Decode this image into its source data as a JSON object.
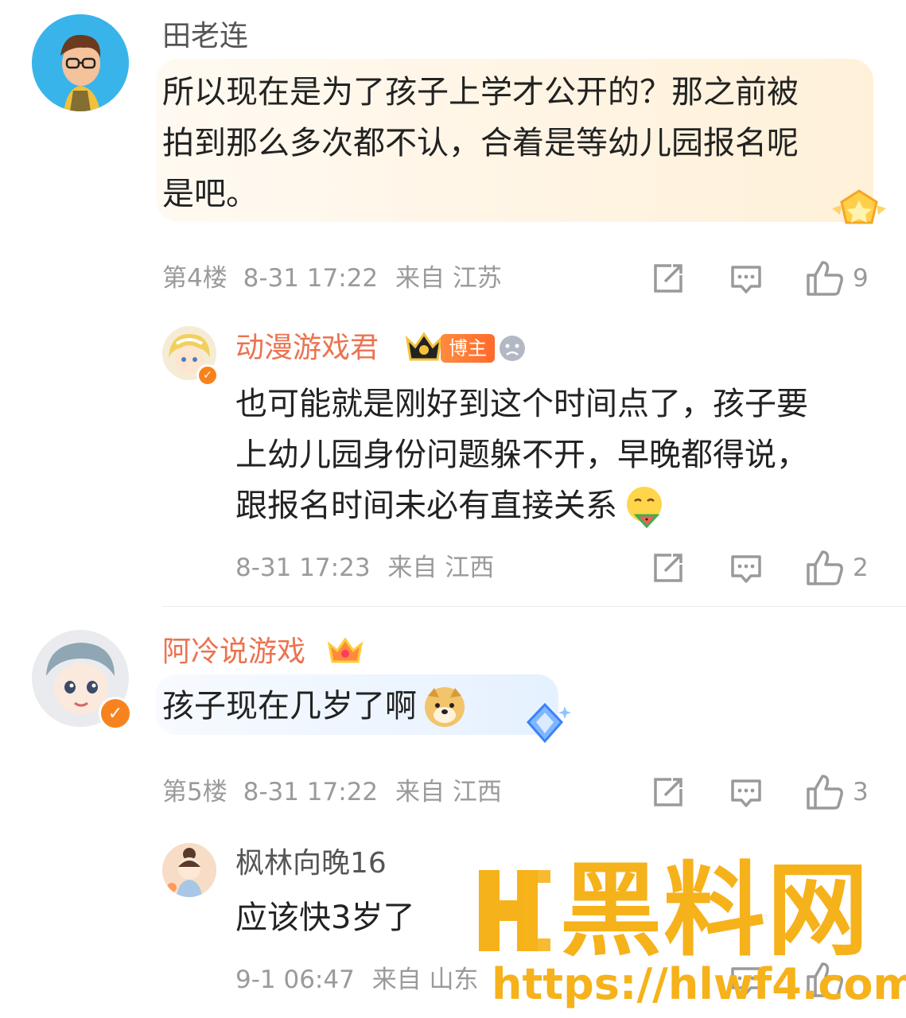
{
  "comments": [
    {
      "user": "田老连",
      "text_lines": [
        "所以现在是为了孩子上学才公开的？那之前被",
        "拍到那么多次都不认，合着是等幼儿园报名呢",
        "是吧。"
      ],
      "floor": "第4楼",
      "time": "8-31 17:22",
      "location": "来自 江苏",
      "likes": "9"
    },
    {
      "user": "动漫游戏君",
      "tag": "博主",
      "text_lines": [
        "也可能就是刚好到这个时间点了，孩子要",
        "上幼儿园身份问题躲不开，早晚都得说，",
        "跟报名时间未必有直接关系"
      ],
      "time": "8-31 17:23",
      "location": "来自 江西",
      "likes": "2"
    },
    {
      "user": "阿冷说游戏",
      "text_lines": [
        "孩子现在几岁了啊"
      ],
      "floor": "第5楼",
      "time": "8-31 17:22",
      "location": "来自 江西",
      "likes": "3"
    },
    {
      "user": "枫林向晚16",
      "text_lines": [
        "应该快3岁了"
      ],
      "time": "9-1 06:47",
      "location": "来自 山东"
    }
  ],
  "icons": {
    "share": "share-icon",
    "comment": "comment-icon",
    "like": "like-icon"
  },
  "watermark": {
    "brand": "黑料网",
    "url": "https://hlwf4.com"
  },
  "colors": {
    "orange_name": "#eb7350",
    "meta_gray": "#9a9a9a",
    "watermark": "#f6b21b"
  }
}
